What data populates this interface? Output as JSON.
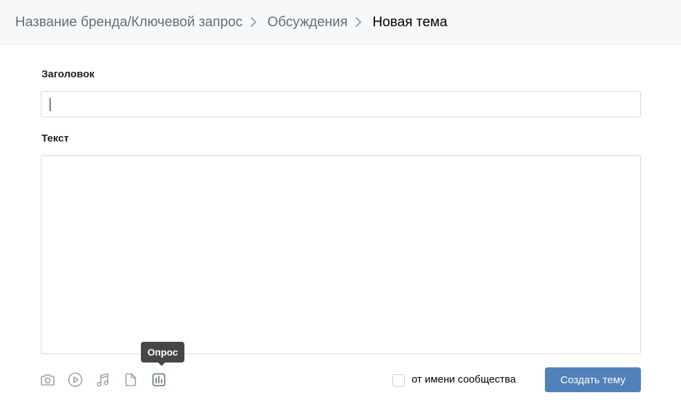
{
  "breadcrumb": {
    "items": [
      "Название бренда/Ключевой запрос",
      "Обсуждения"
    ],
    "current": "Новая тема"
  },
  "form": {
    "title_label": "Заголовок",
    "title_value": "",
    "text_label": "Текст",
    "text_value": ""
  },
  "toolbar": {
    "icons": [
      "camera-icon",
      "video-icon",
      "music-icon",
      "document-icon",
      "poll-icon"
    ],
    "tooltip": "Опрос"
  },
  "footer": {
    "community_checkbox_label": "от имени сообщества",
    "community_checked": false,
    "submit_label": "Создать тему"
  },
  "colors": {
    "header_bg": "#f7f8fa",
    "accent": "#5181b8",
    "icon": "#99a2ad",
    "tooltip_bg": "#454647"
  }
}
